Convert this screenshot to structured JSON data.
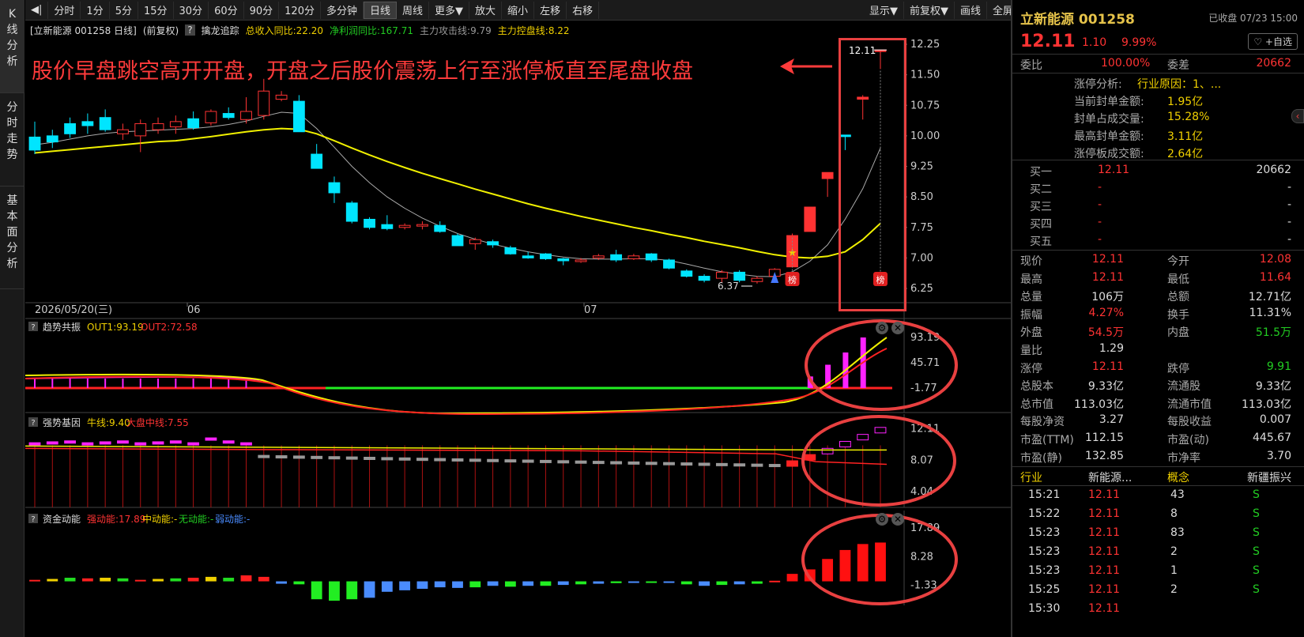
{
  "leftnav": [
    {
      "label": "K线分析",
      "chars": [
        "K",
        "线",
        "分",
        "析"
      ]
    },
    {
      "label": "分时走势",
      "chars": [
        "分",
        "时",
        "走",
        "势"
      ]
    },
    {
      "label": "基本面分析",
      "chars": [
        "基",
        "本",
        "面",
        "分",
        "析"
      ]
    }
  ],
  "toolbar": {
    "collapse": "◀|",
    "periods": [
      "分时",
      "1分",
      "5分",
      "15分",
      "30分",
      "60分",
      "90分",
      "120分",
      "多分钟",
      "日线",
      "周线",
      "更多▼",
      "放大",
      "缩小",
      "左移",
      "右移"
    ],
    "active": "日线",
    "right": [
      "显示▼",
      "前复权▼",
      "画线",
      "全屏"
    ]
  },
  "infobar": {
    "stock": "[立新能源 001258 日线]",
    "adj": "(前复权)",
    "q": "?",
    "indicator": "擒龙追踪",
    "income": "总收入同比:22.20",
    "profit": "净利润同比:167.71",
    "attack": "主力攻击线:9.79",
    "control": "主力控盘线:8.22"
  },
  "annotation": "股价早盘跳空高开开盘，开盘之后股价震荡上行至涨停板直至尾盘收盘",
  "main_chart": {
    "y_ticks": [
      "12.25",
      "11.50",
      "10.75",
      "10.00",
      "9.25",
      "8.50",
      "7.75",
      "7.00",
      "6.25"
    ],
    "x_labels": [
      "2026/05/20(三)",
      "06",
      "07"
    ],
    "high_label": "12.11",
    "low_label": "6.37",
    "badge": "榜",
    "candles": [
      [
        9.97,
        9.65,
        10.35,
        9.55
      ],
      [
        10.0,
        9.85,
        10.15,
        9.7
      ],
      [
        10.3,
        10.05,
        10.45,
        9.95
      ],
      [
        10.35,
        10.25,
        10.55,
        10.05
      ],
      [
        10.45,
        10.15,
        10.65,
        10.1
      ],
      [
        10.05,
        10.15,
        10.3,
        9.9
      ],
      [
        10.0,
        10.3,
        10.4,
        9.6
      ],
      [
        10.15,
        10.3,
        10.45,
        10.05
      ],
      [
        10.22,
        10.35,
        10.5,
        10.05
      ],
      [
        10.42,
        10.2,
        10.6,
        10.15
      ],
      [
        10.32,
        10.6,
        10.65,
        10.25
      ],
      [
        10.55,
        10.45,
        10.7,
        10.4
      ],
      [
        10.4,
        10.6,
        10.95,
        10.3
      ],
      [
        10.5,
        11.1,
        11.4,
        10.4
      ],
      [
        10.9,
        11.0,
        11.1,
        10.85
      ],
      [
        10.85,
        10.1,
        11.0,
        10.1
      ],
      [
        9.55,
        9.2,
        9.8,
        9.2
      ],
      [
        8.85,
        8.6,
        9.0,
        8.35
      ],
      [
        8.35,
        7.9,
        8.4,
        7.85
      ],
      [
        7.95,
        7.75,
        8.0,
        7.7
      ],
      [
        7.82,
        7.72,
        8.05,
        7.68
      ],
      [
        7.75,
        7.8,
        7.85,
        7.7
      ],
      [
        7.8,
        7.82,
        7.9,
        7.7
      ],
      [
        7.8,
        7.65,
        7.9,
        7.62
      ],
      [
        7.55,
        7.3,
        7.6,
        7.3
      ],
      [
        7.35,
        7.45,
        7.5,
        7.2
      ],
      [
        7.4,
        7.32,
        7.45,
        7.25
      ],
      [
        7.25,
        7.1,
        7.3,
        7.08
      ],
      [
        7.05,
        7.0,
        7.15,
        6.98
      ],
      [
        7.1,
        6.98,
        7.12,
        6.95
      ],
      [
        6.98,
        6.93,
        7.0,
        6.82
      ],
      [
        6.92,
        6.95,
        7.0,
        6.88
      ],
      [
        7.0,
        7.05,
        7.1,
        6.95
      ],
      [
        7.08,
        6.95,
        7.2,
        6.9
      ],
      [
        6.98,
        7.05,
        7.1,
        6.95
      ],
      [
        7.1,
        6.95,
        7.12,
        6.9
      ],
      [
        6.95,
        6.75,
        6.98,
        6.72
      ],
      [
        6.68,
        6.55,
        6.72,
        6.52
      ],
      [
        6.55,
        6.45,
        6.6,
        6.4
      ],
      [
        6.5,
        6.65,
        6.7,
        6.4
      ],
      [
        6.65,
        6.45,
        6.7,
        6.4
      ],
      [
        6.42,
        6.5,
        6.55,
        6.37
      ],
      [
        6.55,
        6.72,
        6.75,
        6.5
      ],
      [
        6.78,
        7.55,
        7.6,
        6.78
      ],
      [
        7.65,
        8.25,
        8.25,
        7.65
      ],
      [
        8.95,
        9.1,
        9.1,
        8.5
      ],
      [
        10.02,
        10.0,
        10.02,
        9.65
      ],
      [
        10.9,
        10.95,
        11.0,
        10.4
      ],
      [
        12.08,
        12.11,
        12.11,
        11.64
      ]
    ],
    "ma_slow": [
      9.58,
      9.62,
      9.66,
      9.7,
      9.74,
      9.78,
      9.82,
      9.86,
      9.88,
      9.93,
      9.98,
      10.04,
      10.1,
      10.15,
      10.18,
      10.16,
      10.05,
      9.88,
      9.7,
      9.53,
      9.37,
      9.22,
      9.08,
      8.95,
      8.82,
      8.69,
      8.57,
      8.45,
      8.33,
      8.22,
      8.12,
      8.02,
      7.93,
      7.84,
      7.75,
      7.67,
      7.58,
      7.5,
      7.41,
      7.33,
      7.25,
      7.16,
      7.08,
      7.02,
      7.0,
      7.04,
      7.15,
      7.45,
      7.85
    ],
    "ma_fast": [
      9.78,
      9.84,
      9.92,
      10.0,
      10.06,
      10.1,
      10.12,
      10.14,
      10.16,
      10.18,
      10.22,
      10.28,
      10.36,
      10.48,
      10.58,
      10.55,
      10.18,
      9.72,
      9.25,
      8.85,
      8.5,
      8.22,
      7.98,
      7.78,
      7.6,
      7.46,
      7.34,
      7.24,
      7.15,
      7.08,
      7.02,
      6.98,
      6.97,
      6.97,
      6.98,
      6.98,
      6.94,
      6.85,
      6.75,
      6.66,
      6.6,
      6.55,
      6.54,
      6.66,
      6.92,
      7.32,
      7.95,
      8.7,
      9.7
    ]
  },
  "panel2": {
    "q": "?",
    "name": "趋势共振",
    "out1": "OUT1:93.19",
    "out2": "OUT2:72.58",
    "y_ticks": [
      "93.19",
      "45.71",
      "-1.77"
    ],
    "ticks_v": [
      93.19,
      45.71,
      -1.77
    ]
  },
  "panel3": {
    "q": "?",
    "name": "强势基因",
    "bull": "牛线:9.40",
    "mid": "大盘中线:7.55",
    "y_ticks": [
      "12.11",
      "8.07",
      "4.04"
    ]
  },
  "panel4": {
    "q": "?",
    "name": "资金动能",
    "strong": "强动能:17.89",
    "middle": "中动能:-",
    "none": "无动能:-",
    "weak": "弱动能:-",
    "y_ticks": [
      "17.89",
      "8.28",
      "-1.33"
    ],
    "bars": [
      0.5,
      0.8,
      1.2,
      1.0,
      1.2,
      1.0,
      0.5,
      0.8,
      1.0,
      1.2,
      1.5,
      1.2,
      2.0,
      1.5,
      -0.8,
      -1.0,
      -6.0,
      -6.5,
      -6.0,
      -5.5,
      -3.5,
      -3.0,
      -2.5,
      -2.0,
      -2.2,
      -2.0,
      -1.5,
      -1.8,
      -1.5,
      -1.5,
      -1.2,
      -1.0,
      -0.8,
      -0.6,
      -0.4,
      -0.3,
      -0.5,
      -1.0,
      -1.5,
      -1.2,
      -1.0,
      -0.8,
      0.2,
      2.5,
      4.0,
      7.5,
      10.5,
      12.5,
      13.0,
      13.5
    ]
  },
  "right": {
    "name": "立新能源 001258",
    "status": "已收盘 07/23 15:00",
    "price": "12.11",
    "chg": "1.10",
    "pct": "9.99%",
    "fav": "♡ +自选",
    "webi_l": "委比",
    "webi_v": "100.00%",
    "weicha_l": "委差",
    "weicha_v": "20662",
    "zt": [
      [
        "涨停分析:",
        "行业原因：1、..."
      ],
      [
        "当前封单金额:",
        "1.95亿"
      ],
      [
        "封单占成交量:",
        "15.28%"
      ],
      [
        "最高封单金额:",
        "3.11亿"
      ],
      [
        "涨停板成交额:",
        "2.64亿"
      ]
    ],
    "buys": [
      [
        "买一",
        "12.11",
        "20662"
      ],
      [
        "买二",
        "-",
        "-"
      ],
      [
        "买三",
        "-",
        "-"
      ],
      [
        "买四",
        "-",
        "-"
      ],
      [
        "买五",
        "-",
        "-"
      ]
    ],
    "stats": [
      [
        "现价",
        "12.11",
        "今开",
        "12.08"
      ],
      [
        "最高",
        "12.11",
        "最低",
        "11.64"
      ],
      [
        "总量",
        "106万",
        "总额",
        "12.71亿"
      ],
      [
        "振幅",
        "4.27%",
        "换手",
        "11.31%"
      ],
      [
        "外盘",
        "54.5万",
        "内盘",
        "51.5万"
      ],
      [
        "量比",
        "1.29",
        "",
        ""
      ],
      [
        "涨停",
        "12.11",
        "跌停",
        "9.91"
      ],
      [
        "总股本",
        "9.33亿",
        "流通股",
        "9.33亿"
      ],
      [
        "总市值",
        "113.03亿",
        "流通市值",
        "113.03亿"
      ],
      [
        "每股净资",
        "3.27",
        "每股收益",
        "0.007"
      ],
      [
        "市盈(TTM)",
        "112.15",
        "市盈(动)",
        "445.67"
      ],
      [
        "市盈(静)",
        "132.85",
        "市净率",
        "3.70"
      ]
    ],
    "cats": [
      "行业",
      "新能源...",
      "概念",
      "新疆振兴"
    ],
    "ticks": [
      [
        "15:21",
        "12.11",
        "43",
        "S"
      ],
      [
        "15:22",
        "12.11",
        "8",
        "S"
      ],
      [
        "15:23",
        "12.11",
        "83",
        "S"
      ],
      [
        "15:23",
        "12.11",
        "2",
        "S"
      ],
      [
        "15:23",
        "12.11",
        "1",
        "S"
      ],
      [
        "15:25",
        "12.11",
        "2",
        "S"
      ],
      [
        "15:30",
        "12.11",
        "",
        ""
      ]
    ]
  },
  "colors": {
    "up": "#ff3333",
    "down": "#00e5ff",
    "ma_slow": "#f0f000",
    "ma_fast": "#aaaaaa",
    "highlight": "#e84040",
    "magenta": "#ff22ff",
    "green_line": "#22ee22"
  }
}
